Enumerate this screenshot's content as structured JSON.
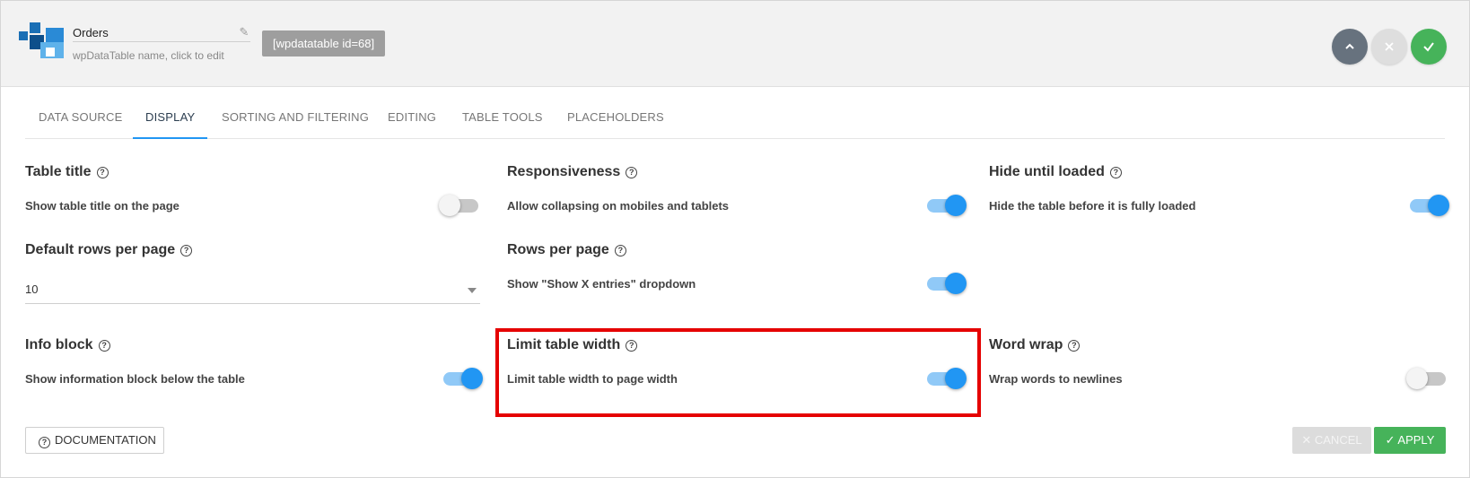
{
  "header": {
    "table_name": "Orders",
    "table_name_hint": "wpDataTable name, click to edit",
    "shortcode": "[wpdatatable id=68]",
    "buttons": {
      "collapse_icon": "chevron-up-icon",
      "close_icon": "close-icon",
      "save_icon": "check-icon"
    }
  },
  "tabs": [
    {
      "label": "DATA SOURCE",
      "active": false
    },
    {
      "label": "DISPLAY",
      "active": true
    },
    {
      "label": "SORTING AND FILTERING",
      "active": false
    },
    {
      "label": "EDITING",
      "active": false
    },
    {
      "label": "TABLE TOOLS",
      "active": false
    },
    {
      "label": "PLACEHOLDERS",
      "active": false
    }
  ],
  "settings": {
    "table_title": {
      "title": "Table title",
      "desc": "Show table title on the page",
      "enabled": false
    },
    "responsiveness": {
      "title": "Responsiveness",
      "desc": "Allow collapsing on mobiles and tablets",
      "enabled": true
    },
    "hide_until_loaded": {
      "title": "Hide until loaded",
      "desc": "Hide the table before it is fully loaded",
      "enabled": true
    },
    "default_rows": {
      "title": "Default rows per page",
      "value": "10"
    },
    "rows_per_page": {
      "title": "Rows per page",
      "desc": "Show \"Show X entries\" dropdown",
      "enabled": true
    },
    "info_block": {
      "title": "Info block",
      "desc": "Show information block below the table",
      "enabled": true
    },
    "limit_width": {
      "title": "Limit table width",
      "desc": "Limit table width to page width",
      "enabled": true
    },
    "word_wrap": {
      "title": "Word wrap",
      "desc": "Wrap words to newlines",
      "enabled": false
    }
  },
  "footer": {
    "documentation": "DOCUMENTATION",
    "cancel": "CANCEL",
    "apply": "APPLY"
  },
  "colors": {
    "accent": "#2196f3",
    "success": "#46b35a",
    "highlight": "#e50000"
  }
}
